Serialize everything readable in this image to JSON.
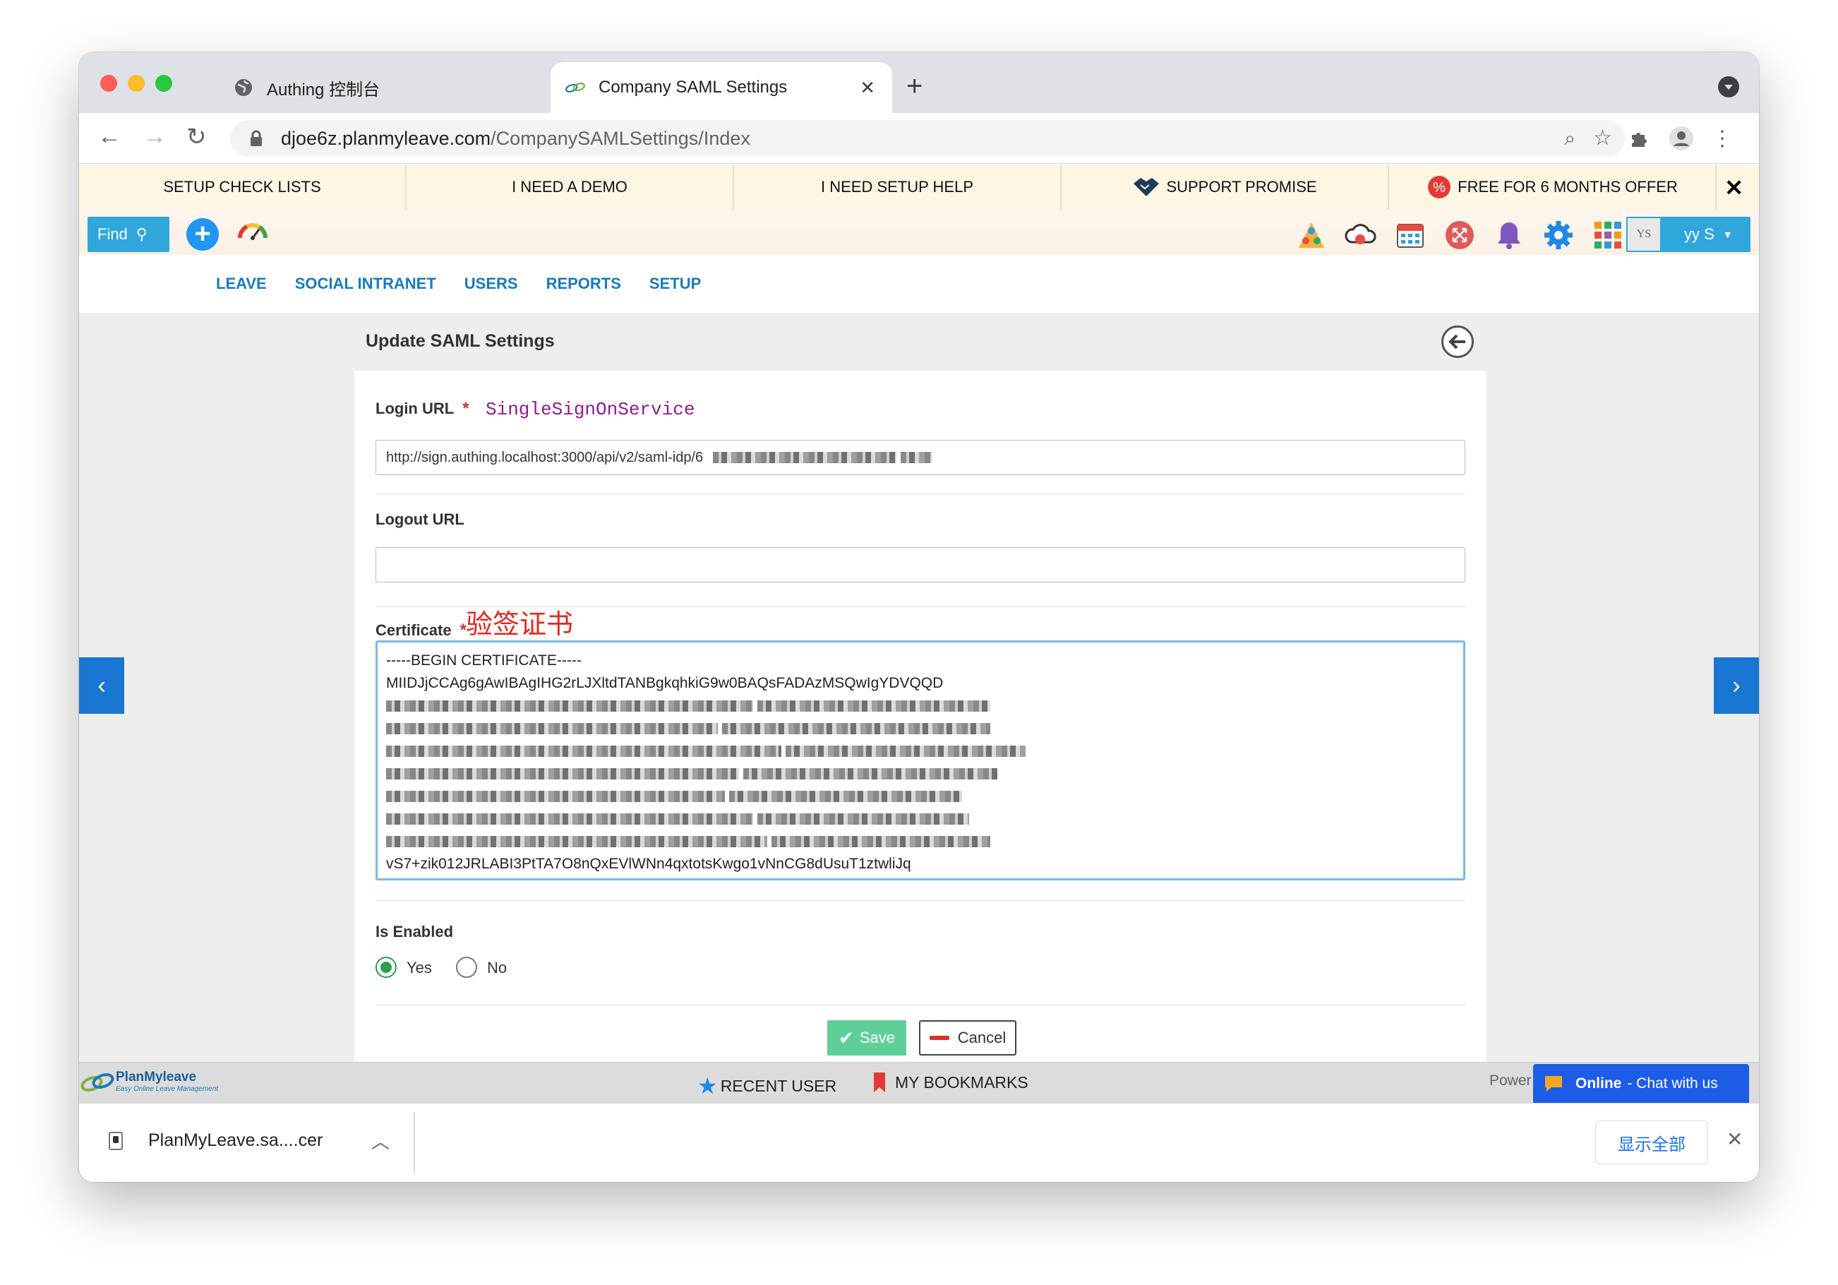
{
  "browser": {
    "tabs": [
      {
        "title": "Authing 控制台"
      },
      {
        "title": "Company SAML Settings"
      }
    ],
    "url_host": "djoe6z.planmyleave.com",
    "url_path": "/CompanySAMLSettings/Index"
  },
  "promo_bar": {
    "items": [
      "SETUP CHECK LISTS",
      "I NEED A DEMO",
      "I NEED SETUP HELP",
      "SUPPORT PROMISE",
      "FREE FOR 6 MONTHS OFFER"
    ]
  },
  "app_bar": {
    "find_label": "Find",
    "user_initials": "YS",
    "user_name": "yy S"
  },
  "main_nav": [
    "LEAVE",
    "SOCIAL INTRANET",
    "USERS",
    "REPORTS",
    "SETUP"
  ],
  "page": {
    "title": "Update SAML Settings",
    "login_url_label": "Login URL",
    "login_url_annotation": "SingleSignOnService",
    "login_url_value": "http://sign.authing.localhost:3000/api/v2/saml-idp/6",
    "logout_url_label": "Logout URL",
    "logout_url_value": "",
    "certificate_label": "Certificate",
    "certificate_annotation": "验签证书",
    "certificate_first_line": "-----BEGIN CERTIFICATE-----",
    "certificate_second_line": "MIIDJjCCAg6gAwIBAgIHG2rLJXltdTANBgkqhkiG9w0BAQsFADAzMSQwIgYDVQQD",
    "certificate_last_line": "vS7+zik012JRLABI3PtTA7O8nQxEVlWNn4qxtotsKwgo1vNnCG8dUsuT1ztwliJq",
    "is_enabled_label": "Is Enabled",
    "is_enabled_options": [
      "Yes",
      "No"
    ],
    "is_enabled_value": "Yes",
    "save_label": "Save",
    "cancel_label": "Cancel",
    "required_marker": "*"
  },
  "footer": {
    "logo_text": "PlanMyleave",
    "logo_tagline": "Easy Online Leave Management",
    "recent_user": "RECENT USER",
    "my_bookmarks": "MY BOOKMARKS",
    "powered_text": "Power",
    "chat_status": "Online",
    "chat_label": "- Chat with us"
  },
  "download_shelf": {
    "file_name": "PlanMyLeave.sa....cer",
    "show_all": "显示全部"
  },
  "colors": {
    "accent_blue": "#2fa7db",
    "nav_blue": "#1a7ab8",
    "required_red": "#d9312b",
    "save_green": "#5fcf9a",
    "chat_blue": "#1d5ce6",
    "annotation_purple": "#8b1d8b"
  },
  "icons": {
    "tab1": "globe-icon",
    "tab2": "chain-link-icon",
    "support": "handshake-icon",
    "offer": "percent-badge-icon"
  }
}
